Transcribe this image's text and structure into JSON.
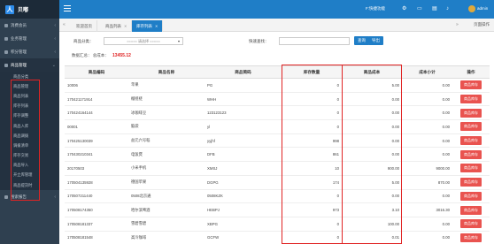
{
  "brand": {
    "name": "贝嘟"
  },
  "sidebar": {
    "groups": [
      {
        "label": "消费会员"
      },
      {
        "label": "业务管理"
      },
      {
        "label": "积分管理"
      },
      {
        "label": "商品管理"
      }
    ],
    "sub_items": [
      {
        "label": "商品分类"
      },
      {
        "label": "商品管理"
      },
      {
        "label": "商品列表"
      },
      {
        "label": "库存列表"
      },
      {
        "label": "库存调整"
      },
      {
        "label": "商品入库"
      },
      {
        "label": "商品调拨"
      },
      {
        "label": "调拨清单"
      },
      {
        "label": "库存交易"
      },
      {
        "label": "商品导入"
      },
      {
        "label": "开立库管理"
      },
      {
        "label": "商品提货时"
      }
    ],
    "bottom": {
      "label": "搜索报告"
    }
  },
  "topbar": {
    "quick_label": "F:快捷功能",
    "user_label": "admin"
  },
  "tabs": {
    "items": [
      {
        "label": "欢迎首页"
      },
      {
        "label": "商品列表"
      },
      {
        "label": "库存列表"
      }
    ],
    "page_ops": "页面操作"
  },
  "filters": {
    "category_label": "商品分类：",
    "category_select": "===== 请选择 =====",
    "quick_search_label": "快速查找：",
    "search_button": "查询",
    "export_button": "导出",
    "summary_label": "数据汇总：",
    "summary_cost_label": "总成本：",
    "summary_cost_value": "13455.12"
  },
  "table": {
    "headers": [
      "商品编码",
      "商品名称",
      "商品简码",
      "库存数量",
      "商品成本",
      "成本小计",
      "操作"
    ],
    "rows": [
      [
        "10006",
        "苹果",
        "PG",
        "0",
        "5.00",
        "0.00",
        "商品库存"
      ],
      [
        "170421171914",
        "榴梿梿",
        "WHH",
        "0",
        "0.00",
        "0.00",
        "商品库存"
      ],
      [
        "170424164144",
        "冰咖啡豆",
        "123123123",
        "0",
        "0.00",
        "0.00",
        "商品库存"
      ],
      [
        "00001",
        "脑袋",
        "yl",
        "0",
        "0.00",
        "0.00",
        "商品库存"
      ],
      [
        "170425130039",
        "益元六号稻",
        "yyjhf",
        "998",
        "0.00",
        "0.00",
        "商品库存"
      ],
      [
        "170430210341",
        "电饭煲",
        "DFB",
        "861",
        "0.00",
        "0.00",
        "商品库存"
      ],
      [
        "20170503",
        "小米手机",
        "XMSJ",
        "10",
        "900.00",
        "9000.00",
        "商品库存"
      ],
      [
        "170504135928",
        "德国苹果",
        "DGPG",
        "174",
        "5.00",
        "870.00",
        "商品库存"
      ],
      [
        "170507211440",
        "0508北京通",
        "0508KZK",
        "0",
        "0.00",
        "0.00",
        "商品库存"
      ],
      [
        "170508174350",
        "哈尔滨啤酒",
        "HEBPJ",
        "973",
        "3.10",
        "3016.30",
        "商品库存"
      ],
      [
        "170508181337",
        "雪碧雪碧",
        "XBPG",
        "0",
        "100.00",
        "0.00",
        "商品库存"
      ],
      [
        "170508181548",
        "高冷咖啡",
        "GCFW",
        "0",
        "0.01",
        "0.00",
        "商品库存"
      ]
    ]
  }
}
